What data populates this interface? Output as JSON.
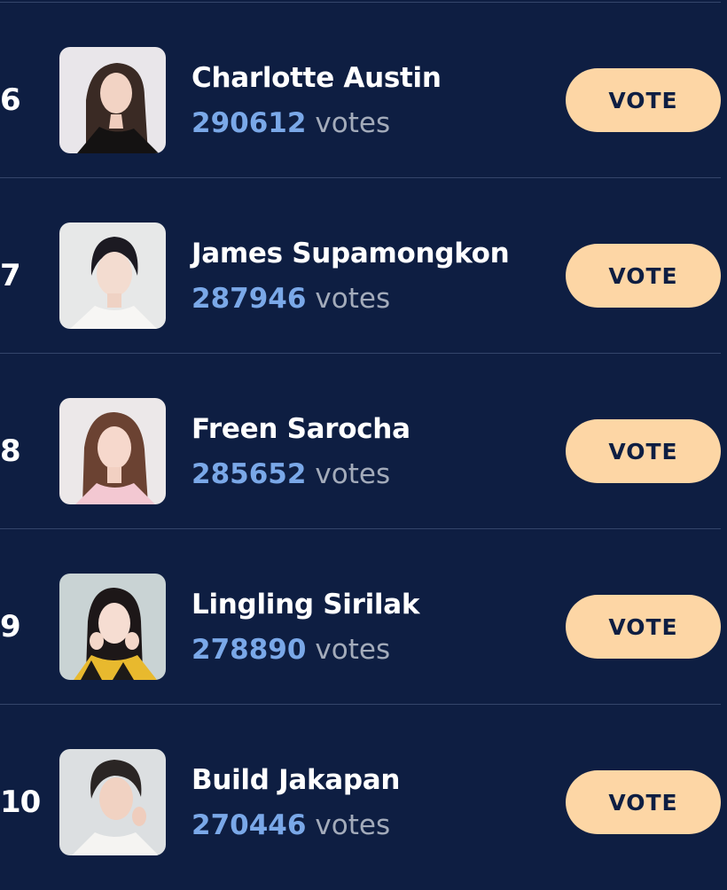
{
  "leaderboard": {
    "entries": [
      {
        "rank": "6",
        "name": "Charlotte Austin",
        "votes": "290612",
        "votes_unit": "votes",
        "button_label": "VOTE"
      },
      {
        "rank": "7",
        "name": "James Supamongkon",
        "votes": "287946",
        "votes_unit": "votes",
        "button_label": "VOTE"
      },
      {
        "rank": "8",
        "name": "Freen Sarocha",
        "votes": "285652",
        "votes_unit": "votes",
        "button_label": "VOTE"
      },
      {
        "rank": "9",
        "name": "Lingling Sirilak",
        "votes": "278890",
        "votes_unit": "votes",
        "button_label": "VOTE"
      },
      {
        "rank": "10",
        "name": "Build Jakapan",
        "votes": "270446",
        "votes_unit": "votes",
        "button_label": "VOTE"
      }
    ]
  },
  "colors": {
    "background": "#0e1e42",
    "accent_button": "#fdd6a5",
    "vote_count": "#7aa8e8",
    "vote_unit": "#a3abba",
    "divider": "#34456a"
  }
}
